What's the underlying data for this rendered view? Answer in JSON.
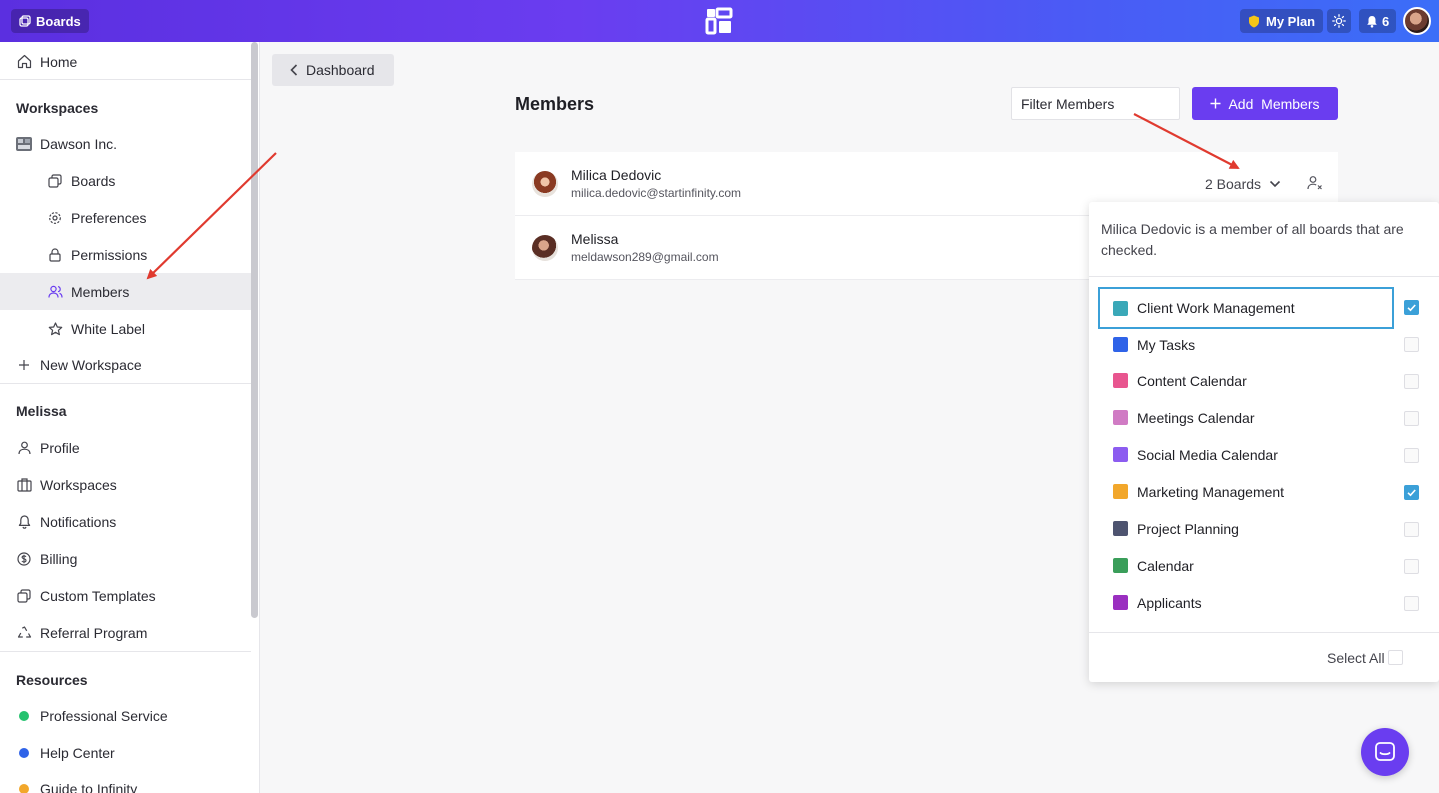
{
  "topbar": {
    "boards_label": "Boards",
    "plan_label": "My Plan",
    "notif_count": "6"
  },
  "sidebar": {
    "home": "Home",
    "workspaces_head": "Workspaces",
    "workspace_name": "Dawson Inc.",
    "ws_items": [
      "Boards",
      "Preferences",
      "Permissions",
      "Members",
      "White Label"
    ],
    "new_workspace": "New Workspace",
    "user_head": "Melissa",
    "user_items": [
      "Profile",
      "Workspaces",
      "Notifications",
      "Billing",
      "Custom Templates",
      "Referral Program"
    ],
    "resources_head": "Resources",
    "resource_items": [
      "Professional Service",
      "Help Center",
      "Guide to Infinity"
    ]
  },
  "main": {
    "back_label": "Dashboard",
    "title": "Members",
    "filter_placeholder": "Filter Members",
    "add_label": "Add  Members",
    "members": [
      {
        "name": "Milica Dedovic",
        "email": "milica.dedovic@startinfinity.com",
        "boards": "2 Boards"
      },
      {
        "name": "Melissa",
        "email": "meldawson289@gmail.com"
      }
    ]
  },
  "popover": {
    "description": "Milica Dedovic is a member of all boards that are checked.",
    "boards": [
      {
        "name": "Client Work Management",
        "color": "#3aa8b8",
        "checked": true
      },
      {
        "name": "My Tasks",
        "color": "#2f63e8",
        "checked": false
      },
      {
        "name": "Content Calendar",
        "color": "#e8558f",
        "checked": false
      },
      {
        "name": "Meetings Calendar",
        "color": "#d07bc4",
        "checked": false
      },
      {
        "name": "Social Media Calendar",
        "color": "#8c5cf0",
        "checked": false
      },
      {
        "name": "Marketing Management",
        "color": "#f2a72b",
        "checked": true
      },
      {
        "name": "Project Planning",
        "color": "#4e5470",
        "checked": false
      },
      {
        "name": "Calendar",
        "color": "#3a9e5a",
        "checked": false
      },
      {
        "name": "Applicants",
        "color": "#9a2fc0",
        "checked": false
      }
    ],
    "select_all": "Select All"
  },
  "colors": {
    "accent": "#6a3df0",
    "check": "#3ba0d8"
  }
}
